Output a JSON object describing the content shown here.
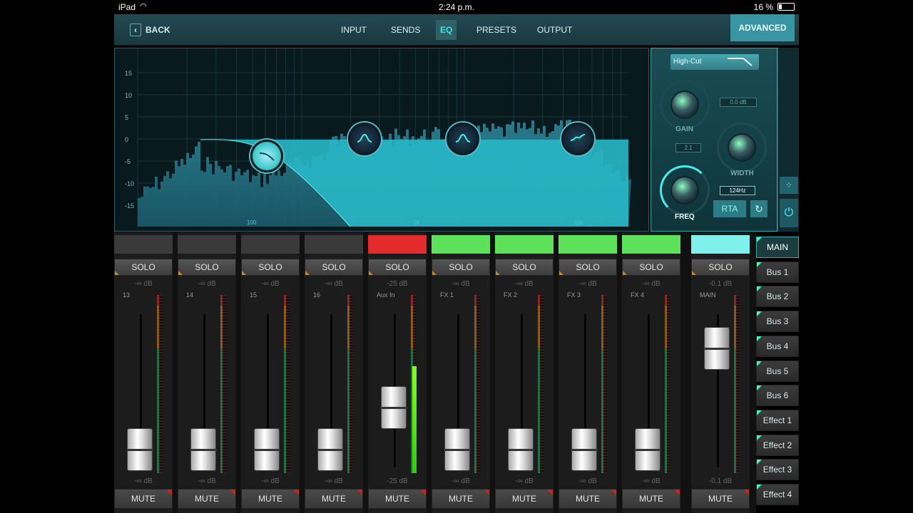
{
  "status": {
    "device": "iPad",
    "time": "2:24 p.m.",
    "battery": "16 %"
  },
  "nav": {
    "back": "BACK",
    "tabs": [
      {
        "label": "INPUT",
        "active": false
      },
      {
        "label": "SENDS",
        "active": false
      },
      {
        "label": "EQ",
        "active": true
      },
      {
        "label": "PRESETS",
        "active": false
      },
      {
        "label": "OUTPUT",
        "active": false
      }
    ],
    "advanced": "ADVANCED"
  },
  "eq": {
    "db_labels": [
      "15",
      "10",
      "5",
      "0",
      "-5",
      "-10",
      "-15"
    ],
    "hz_labels": [
      "100",
      "1K",
      "10K"
    ],
    "filter_type": "High-Cut",
    "gain_label": "GAIN",
    "gain_value": "0.0 dB",
    "width_label": "WIDTH",
    "width_value": "2.1",
    "freq_label": "FREQ",
    "freq_value": "124Hz",
    "rta_label": "RTA"
  },
  "channels": [
    {
      "solo": "SOLO",
      "db_top": "-∞ dB",
      "name": "13",
      "db_bot": "-∞ dB",
      "mute": "MUTE",
      "color": "#3a3a3a",
      "level": 0
    },
    {
      "solo": "SOLO",
      "db_top": "-∞ dB",
      "name": "14",
      "db_bot": "-∞ dB",
      "mute": "MUTE",
      "color": "#3a3a3a",
      "level": 0
    },
    {
      "solo": "SOLO",
      "db_top": "-∞ dB",
      "name": "15",
      "db_bot": "-∞ dB",
      "mute": "MUTE",
      "color": "#3a3a3a",
      "level": 0
    },
    {
      "solo": "SOLO",
      "db_top": "-∞ dB",
      "name": "16",
      "db_bot": "-∞ dB",
      "mute": "MUTE",
      "color": "#3a3a3a",
      "level": 0
    },
    {
      "solo": "SOLO",
      "db_top": "-25 dB",
      "name": "Aux In",
      "db_bot": "-25 dB",
      "mute": "MUTE",
      "color": "#e32b2b",
      "level": 0.6
    },
    {
      "solo": "SOLO",
      "db_top": "-∞ dB",
      "name": "FX 1",
      "db_bot": "-∞ dB",
      "mute": "MUTE",
      "color": "#5de05a",
      "level": 0
    },
    {
      "solo": "SOLO",
      "db_top": "-∞ dB",
      "name": "FX 2",
      "db_bot": "-∞ dB",
      "mute": "MUTE",
      "color": "#5de05a",
      "level": 0
    },
    {
      "solo": "SOLO",
      "db_top": "-∞ dB",
      "name": "FX 3",
      "db_bot": "-∞ dB",
      "mute": "MUTE",
      "color": "#5de05a",
      "level": 0
    },
    {
      "solo": "SOLO",
      "db_top": "-∞ dB",
      "name": "FX 4",
      "db_bot": "-∞ dB",
      "mute": "MUTE",
      "color": "#5de05a",
      "level": 0
    },
    {
      "solo": "SOLO",
      "db_top": "-0.1 dB",
      "name": "MAIN",
      "db_bot": "-0.1 dB",
      "mute": "MUTE",
      "color": "#7ff0ec",
      "level": 0
    }
  ],
  "buses": [
    {
      "label": "MAIN",
      "active": true
    },
    {
      "label": "Bus 1",
      "active": false
    },
    {
      "label": "Bus 2",
      "active": false
    },
    {
      "label": "Bus 3",
      "active": false
    },
    {
      "label": "Bus 4",
      "active": false
    },
    {
      "label": "Bus 5",
      "active": false
    },
    {
      "label": "Bus 6",
      "active": false
    },
    {
      "label": "Effect 1",
      "active": false
    },
    {
      "label": "Effect 2",
      "active": false
    },
    {
      "label": "Effect 3",
      "active": false
    },
    {
      "label": "Effect 4",
      "active": false
    }
  ]
}
